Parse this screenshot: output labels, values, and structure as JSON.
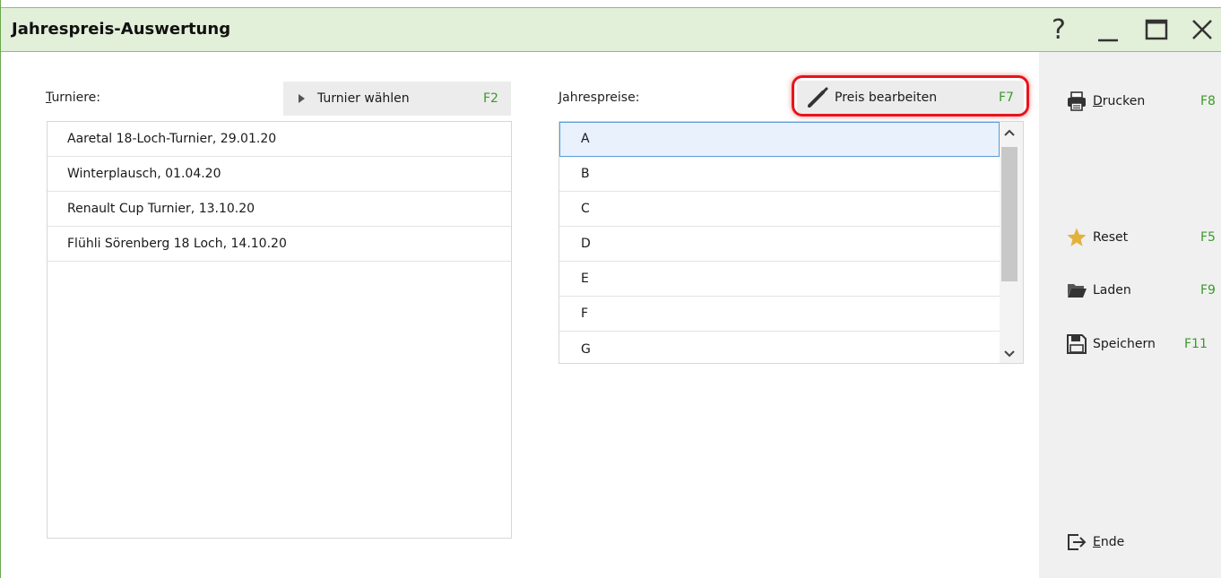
{
  "window": {
    "title": "Jahrespreis-Auswertung",
    "controls": {
      "help": "?",
      "minimize": "_",
      "maximize": "□",
      "close": "X"
    }
  },
  "tournaments": {
    "label_first": "T",
    "label_rest": "urniere:",
    "select_button": {
      "label": "Turnier wählen",
      "key": "F2"
    },
    "items": [
      "Aaretal 18-Loch-Turnier, 29.01.20",
      "Winterplausch, 01.04.20",
      "Renault Cup Turnier, 13.10.20",
      "Flühli Sörenberg 18 Loch, 14.10.20"
    ]
  },
  "prizes": {
    "label_first": "J",
    "label_rest": "ahrespreise:",
    "edit_button": {
      "label": "Preis bearbeiten",
      "key": "F7"
    },
    "items": [
      "A",
      "B",
      "C",
      "D",
      "E",
      "F",
      "G"
    ],
    "selected_index": 0
  },
  "sidebar": {
    "print": {
      "label_first": "D",
      "label_rest": "rucken",
      "key": "F8",
      "icon": "printer-icon"
    },
    "reset": {
      "label": "Reset",
      "key": "F5",
      "icon": "star-icon"
    },
    "load": {
      "label": "Laden",
      "key": "F9",
      "icon": "folder-icon"
    },
    "save": {
      "label": "Speichern",
      "key": "F11",
      "icon": "save-icon"
    },
    "exit": {
      "label_first": "E",
      "label_rest": "nde",
      "icon": "exit-icon"
    }
  },
  "colors": {
    "titlebar_bg": "#e2efd9",
    "hotkey": "#3a9a28",
    "highlight": "#e8141b",
    "selection_border": "#5b9bd5"
  }
}
